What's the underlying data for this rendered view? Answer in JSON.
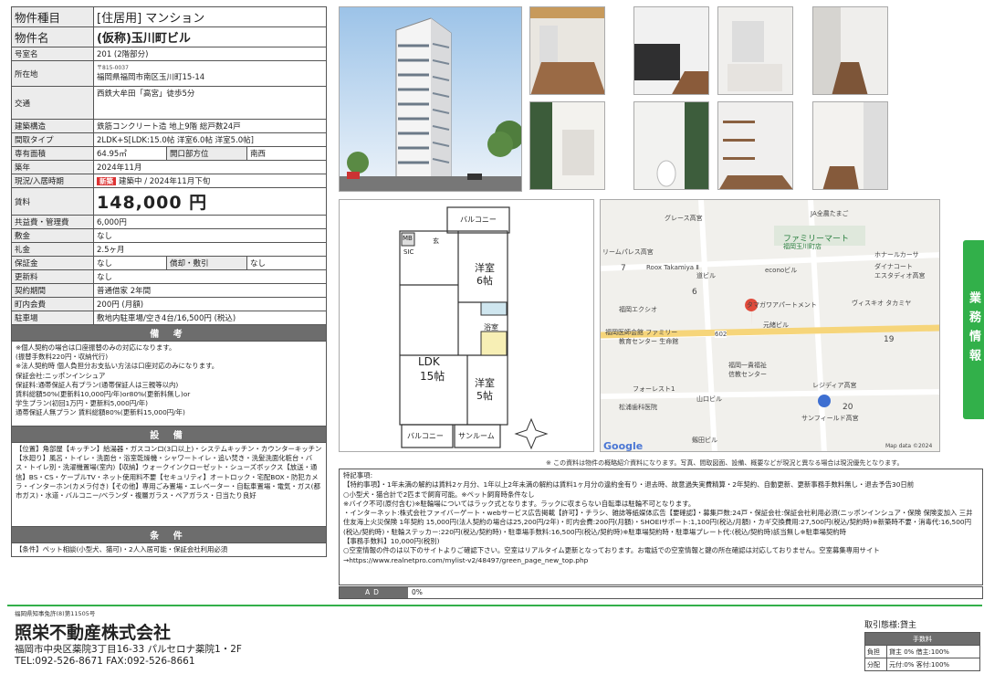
{
  "spec": {
    "type_k": "物件種目",
    "type_v": "[住居用] マンション",
    "name_k": "物件名",
    "name_v": "(仮称)玉川町ビル",
    "room_k": "号室名",
    "room_v": "201 (2階部分)",
    "addr_k": "所在地",
    "addr_zip": "〒815-0037",
    "addr_v": "福岡県福岡市南区玉川町15-14",
    "traffic_k": "交通",
    "traffic_v": "西鉄大牟田「高宮」徒歩5分",
    "struct_k": "建築構造",
    "struct_v": "鉄筋コンクリート造 地上9階 総戸数24戸",
    "layout_k": "間取タイプ",
    "layout_v": "2LDK+S[LDK:15.0帖 洋室6.0帖 洋室5.0帖]",
    "area_k": "専有面積",
    "area_v": "64.95㎡",
    "dir_k": "開口部方位",
    "dir_v": "南西",
    "built_k": "築年",
    "built_v": "2024年11月",
    "status_k": "現況/入居時期",
    "status_badge": "新築",
    "status_v": "建築中 / 2024年11月下旬",
    "rent_k": "賃料",
    "rent_v": "148,000 円",
    "common_k": "共益費・管理費",
    "common_v": "6,000円",
    "deposit_k": "敷金",
    "deposit_v": "なし",
    "key_k": "礼金",
    "key_v": "2.5ヶ月",
    "hosho_k": "保証金",
    "hosho_v": "なし",
    "shokyaku_k": "償却・敷引",
    "shokyaku_v": "なし",
    "renew_k": "更新料",
    "renew_v": "なし",
    "contract_k": "契約期間",
    "contract_v": "普通借家 2年間",
    "town_k": "町内会費",
    "town_v": "200円 (月額)",
    "parking_k": "駐車場",
    "parking_v": "敷地内駐車場/空き4台/16,500円 (税込)",
    "remarks_h": "備 考",
    "remarks": "※個人契約の場合は口座振替のみの対応になります。\n (振替手数料220円・収納代行)\n※法人契約時 個人負担分お支払い方法は口座対応のみになります。\n保証会社:ニッポンインシュア\n保証料:通帯保証人有プラン(通帯保証人は三親等以内)\n 賃料総額50%(更新料10,000円/年)or80%(更新料無し)or\n 学生プラン(初回1万円・更新料5,000円/年)\n 通帯保証人無プラン 賃料総額80%(更新料15,000円/年)",
    "equip_h": "設 備",
    "equip": "【位置】角部屋【キッチン】給湯器・ガスコンロ(3口以上)・システムキッチン・カウンターキッチン【水廻り】風呂・トイレ・洗面台・浴室乾燥機・シャワートイレ・追い焚き・洗髪洗面化粧台・バス・トイレ別・洗濯機置場(室内)【収納】ウォークインクローゼット・シューズボックス【放送・通信】BS・CS・ケーブルTV・ネット使用料不要【セキュリティ】オートロック・宅配BOX・防犯カメラ・インターホン(カメラ付き)【その他】専用ごみ置場・エレベーター・自転車置場・電気・ガス(都市ガス)・水道・バルコニー/ベランダ・複層ガラス・ペアガラス・日当たり良好",
    "cond_h": "条 件",
    "cond": "【条件】ペット相談(小型犬、猫可)・2人入居可能・保証会社利用必須"
  },
  "floorplan": {
    "balcony_top": "バルコニー",
    "mb": "MB",
    "sic": "SIC",
    "gen": "玄",
    "wardrobe1": "洋室",
    "wardrobe1_size": "6帖",
    "bath": "浴室",
    "ldk": "LDK",
    "ldk_size": "15帖",
    "wardrobe2": "洋室",
    "wardrobe2_size": "5帖",
    "balcony_bottom": "バルコニー",
    "sunroom": "サンルーム"
  },
  "map": {
    "labels": [
      "グレース高宮",
      "JA全農たまご",
      "ファミリーマート",
      "福岡玉川町店",
      "ホナールカーサ",
      "ダイナコート",
      "エスタディオ高宮",
      "リームパレス高宮",
      "Roox Takamiya Ⅱ",
      "道ビル",
      "econoビル",
      "タマガワアパートメント",
      "ヴィスキオ タカミヤ",
      "福岡エクシオ",
      "福岡医師会館 ファミリー",
      "教育センター 生命館",
      "602",
      "元緒ビル",
      "19",
      "福岡一貴福祉",
      "信教センター",
      "フォーレスト1",
      "レジディア高宮",
      "山口ビル",
      "松浦歯科医院",
      "20",
      "サンフィールド高宮",
      "剱田ビル",
      "Google",
      "Map data ©2024"
    ],
    "block_6": "6",
    "block_7": "7"
  },
  "side_label": "業務情報",
  "note": "※ この資料は物件の概略紹介資料になります。写真、間取図面、設備、概要などが現況と異なる場合は現況優先となります。",
  "special": "特記事項:\n【特約事項】・1年未満の解約は賃料2ヶ月分、1年以上2年未満の解約は賃料1ヶ月分の違約金有り・退去時、故意過失実費精算・2年契約、自動更新、更新事務手数料無し・退去予告30日前\n○小型犬・猫合計で2匹まで飼育可能。※ペット飼育時条件なし\n※バイク不可(原付含む)※駐輪場についてはラック式となります。ラックに収まらない自転車は駐輪不可となります。\n・インターネット:株式会社ファイバーゲート・webサービス広告掲載【許可】・チラシ、雑誌等紙媒体広告【要確認】・募集戸数:24戸・保証会社:保証会社利用必須(ニッポンインシュア・保険 保険変加入 三井住友海上火災保険 1年契約 15,000円(法人契約の場合は25,200円/2年)・町内会費:200円(月額)・SHOEIサポート:1,100円(税込/月額)・カギ交換費用:27,500円(税込/契約時)※新築時不要・消毒代:16,500円(税込/契約時)・駐輪ステッカー:220円(税込/契約時)・駐車場手数料:16,500円(税込/契約時)※駐車場契約時・駐車場プレート代:(税込/契約時)該当無し※駐車場契約時\n【事務手数料】10,000円(税別)\n○空室情報の件のは以下のサイトよりご確認下さい。空室はリアルタイム更新となっております。お電話での空室情報と鍵の所在確認は対応しておりません。空室募集専用サイト→https://www.realnetpro.com/mylist-v2/48497/green_page_new_top.php",
  "ad_label": "AD",
  "ad_value": "0%",
  "footer": {
    "license": "福岡県知事免許(8)第11505号",
    "company": "照栄不動産株式会社",
    "address": "福岡市中央区薬院3丁目16-33 パルセロナ薬院1・2F",
    "tel": "TEL:092-526-8671 FAX:092-526-8661",
    "deal_title": "取引態様:貸主",
    "fee_head": "手数料",
    "row1_k": "負担",
    "row1_v": "貸主 0% 借主:100%",
    "row2_k": "分配",
    "row2_v": "元付:0% 客付:100%"
  }
}
